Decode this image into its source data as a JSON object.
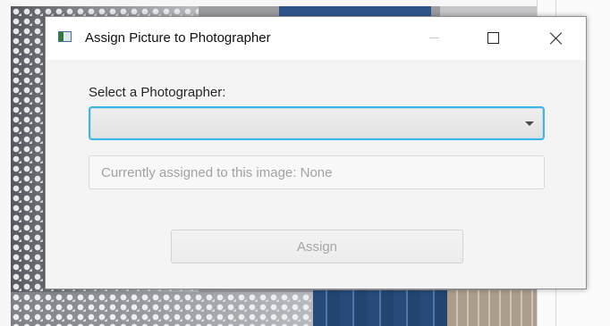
{
  "window": {
    "title": "Assign Picture to Photographer",
    "icon": "app-window-icon",
    "controls": {
      "minimize_icon": "minimize-icon",
      "maximize_icon": "maximize-icon",
      "close_icon": "close-icon"
    }
  },
  "form": {
    "select_label": "Select a Photographer:",
    "photographer_select": {
      "selected_value": "",
      "focused": true,
      "arrow_icon": "chevron-down-icon"
    },
    "assigned_field": {
      "text": "Currently assigned to this image: None",
      "disabled": true
    },
    "assign_button": {
      "label": "Assign",
      "disabled": true
    }
  },
  "colors": {
    "focus_ring": "#3ab6e7",
    "disabled_text": "#a2a2a2",
    "dialog_background": "#f4f4f4"
  }
}
